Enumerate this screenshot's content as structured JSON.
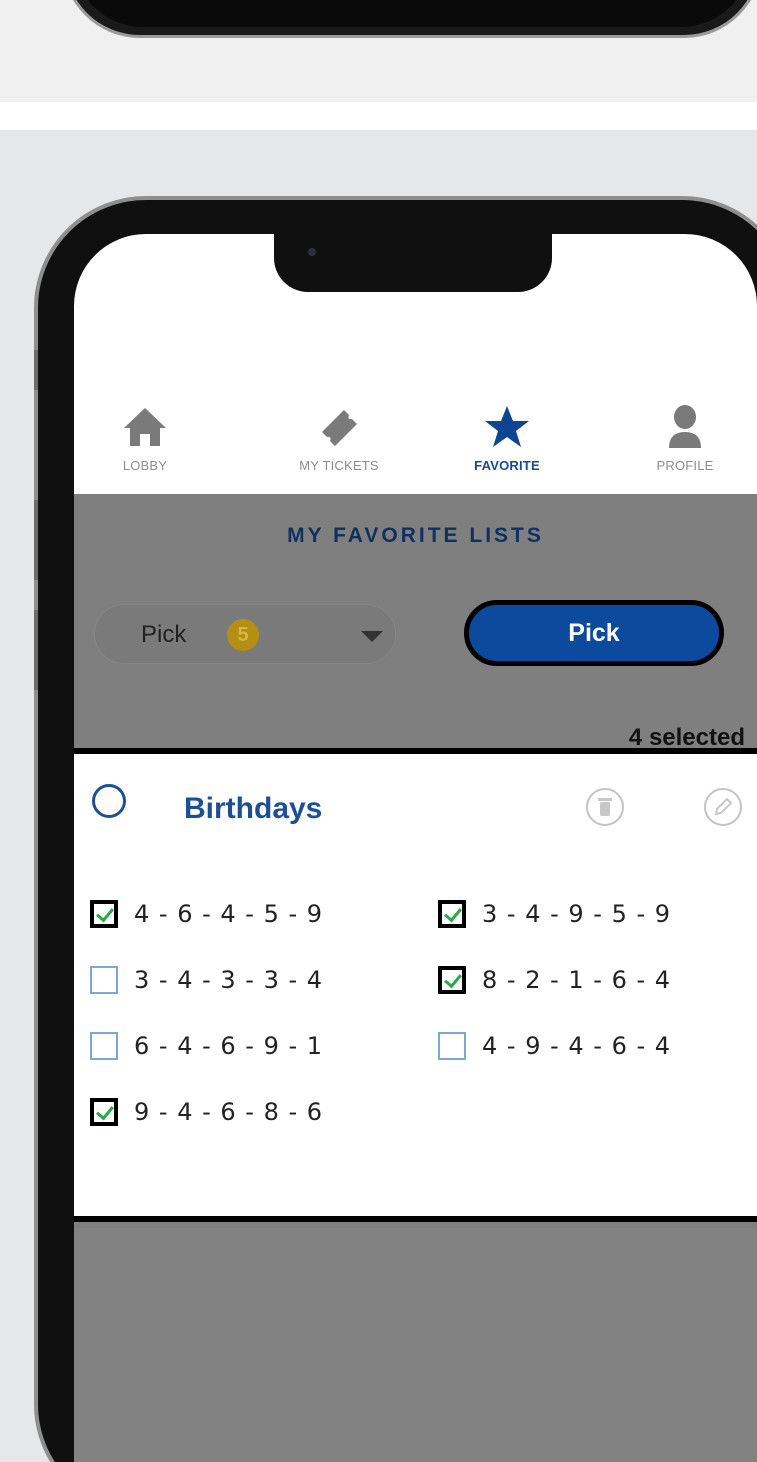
{
  "tabs": [
    {
      "label": "LOBBY",
      "icon": "home-icon"
    },
    {
      "label": "MY TICKETS",
      "icon": "ticket-icon"
    },
    {
      "label": "FAVORITE",
      "icon": "star-icon",
      "active": true
    },
    {
      "label": "PROFILE",
      "icon": "profile-icon"
    }
  ],
  "page": {
    "title": "MY FAVORITE LISTS"
  },
  "pick_select": {
    "label": "Pick",
    "badge": "5"
  },
  "pick_button": {
    "label": "Pick"
  },
  "selection": {
    "text": "4 selected"
  },
  "list": {
    "name": "Birthdays",
    "numbers": [
      {
        "value": "4 - 6 - 4 - 5 - 9",
        "checked": true
      },
      {
        "value": "3 - 4 - 9 - 5 - 9",
        "checked": true
      },
      {
        "value": "3 - 4 - 3 - 3 - 4",
        "checked": false
      },
      {
        "value": "8 - 2 - 1 - 6 - 4",
        "checked": true
      },
      {
        "value": "6 - 4 - 6 - 9 - 1",
        "checked": false
      },
      {
        "value": "4 - 9 - 4 - 6 - 4",
        "checked": false
      },
      {
        "value": "9 - 4 - 6 - 8 - 6",
        "checked": true
      }
    ]
  },
  "colors": {
    "brand_blue": "#1d4f94",
    "button_blue": "#0c4a9e",
    "overlay": "#7f7f7f",
    "badge": "#b58f14",
    "check": "#2aa84a"
  }
}
